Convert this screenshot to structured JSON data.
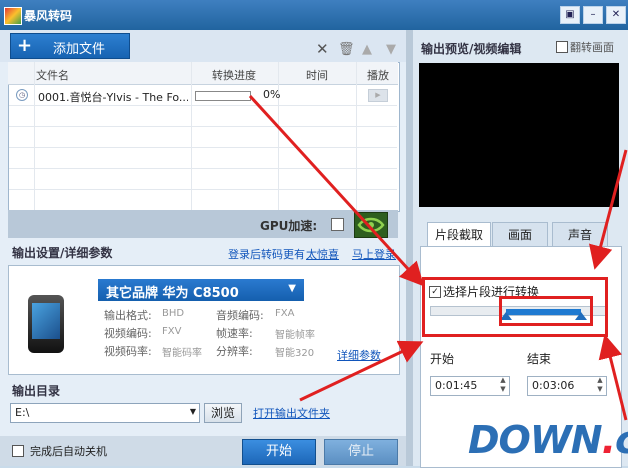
{
  "window": {
    "title": "暴风转码",
    "buttons": [
      "▣",
      "–",
      "✕"
    ]
  },
  "toolbar": {
    "add_label": "添加文件",
    "icons": [
      "close-icon",
      "delete-icon",
      "move-up-icon",
      "move-down-icon"
    ]
  },
  "table": {
    "headers": [
      "文件名",
      "转换进度",
      "时间",
      "播放"
    ],
    "rows": [
      {
        "name": "0001.音悦台-Ylvis - The Fo...",
        "progress": 0,
        "progress_label": "0%",
        "time": ""
      }
    ]
  },
  "gpu": {
    "label": "GPU加速:"
  },
  "output": {
    "title": "输出设置/详细参数",
    "promo": "登录后转码更有",
    "promo_link": "太惊喜",
    "login_link": "马上登录",
    "device": "其它品牌  华为  C8500",
    "params": [
      {
        "label": "输出格式:",
        "value": "BHD"
      },
      {
        "label": "音频编码:",
        "value": "FXA"
      },
      {
        "label": "视频编码:",
        "value": "FXV"
      },
      {
        "label": "帧速率:",
        "value": "智能帧率"
      },
      {
        "label": "视频码率:",
        "value": "智能码率"
      },
      {
        "label": "分辨率:",
        "value": "智能320"
      }
    ],
    "detail_link": "详细参数"
  },
  "directory": {
    "title": "输出目录",
    "value": "E:\\",
    "browse": "浏览",
    "open_link": "打开输出文件夹"
  },
  "bottom": {
    "shutdown_label": "完成后自动关机",
    "start": "开始",
    "stop": "停止"
  },
  "preview": {
    "title": "输出预览/视频编辑",
    "flip_label": "翻转画面"
  },
  "tabs": [
    "片段截取",
    "画面",
    "声音"
  ],
  "clip": {
    "select_label": "选择片段进行转换",
    "checked": true,
    "range_start_fraction": 0.43,
    "range_end_fraction": 0.86,
    "start_label": "开始",
    "end_label": "结束",
    "start_time": "0:01:45",
    "end_time": "0:03:06"
  },
  "watermark": {
    "main": "DOWN",
    "dot": ".",
    "suffix": "cc"
  },
  "colors": {
    "title_bar": "#21649f",
    "accent_blue": "#1f7ad1",
    "annotation_red": "#e02020"
  }
}
